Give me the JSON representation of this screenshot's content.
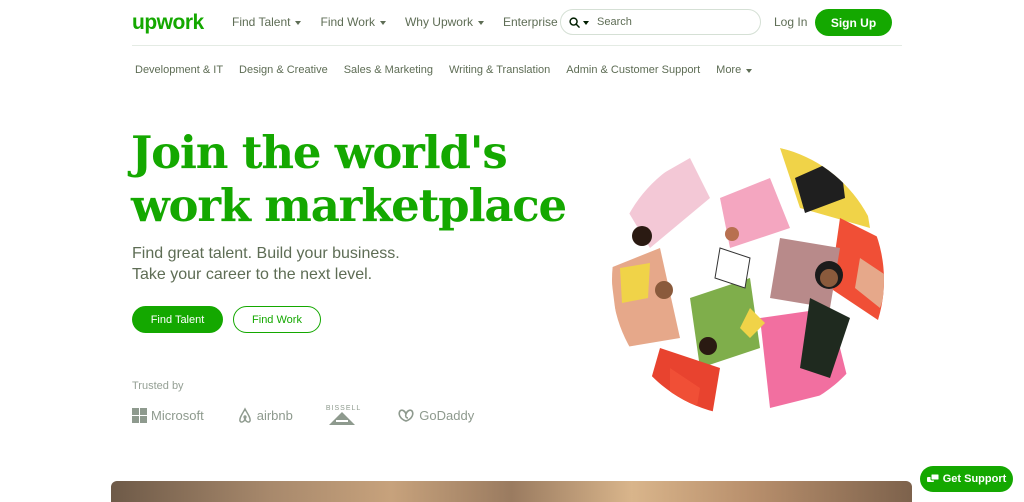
{
  "brand": {
    "logo_text": "upwork",
    "accent": "#14a800"
  },
  "topnav": {
    "links": [
      {
        "label": "Find Talent",
        "dropdown": true
      },
      {
        "label": "Find Work",
        "dropdown": true
      },
      {
        "label": "Why Upwork",
        "dropdown": true
      },
      {
        "label": "Enterprise",
        "dropdown": false
      }
    ],
    "search_placeholder": "Search",
    "login_label": "Log In",
    "signup_label": "Sign Up"
  },
  "categories": {
    "items": [
      "Development & IT",
      "Design & Creative",
      "Sales & Marketing",
      "Writing & Translation",
      "Admin & Customer Support"
    ],
    "more_label": "More"
  },
  "hero": {
    "title_line1": "Join the world's",
    "title_line2": "work marketplace",
    "subtitle_line1": "Find great talent. Build your business.",
    "subtitle_line2": "Take your career to the next level.",
    "find_talent_label": "Find Talent",
    "find_work_label": "Find Work"
  },
  "trusted": {
    "label": "Trusted by",
    "logos": [
      {
        "name": "Microsoft",
        "icon": "microsoft-logo"
      },
      {
        "name": "airbnb",
        "icon": "airbnb-logo"
      },
      {
        "name": "BISSELL",
        "icon": "bissell-logo"
      },
      {
        "name": "GoDaddy",
        "icon": "godaddy-logo"
      }
    ]
  },
  "support": {
    "label": "Get Support",
    "icon": "chat-icon"
  }
}
